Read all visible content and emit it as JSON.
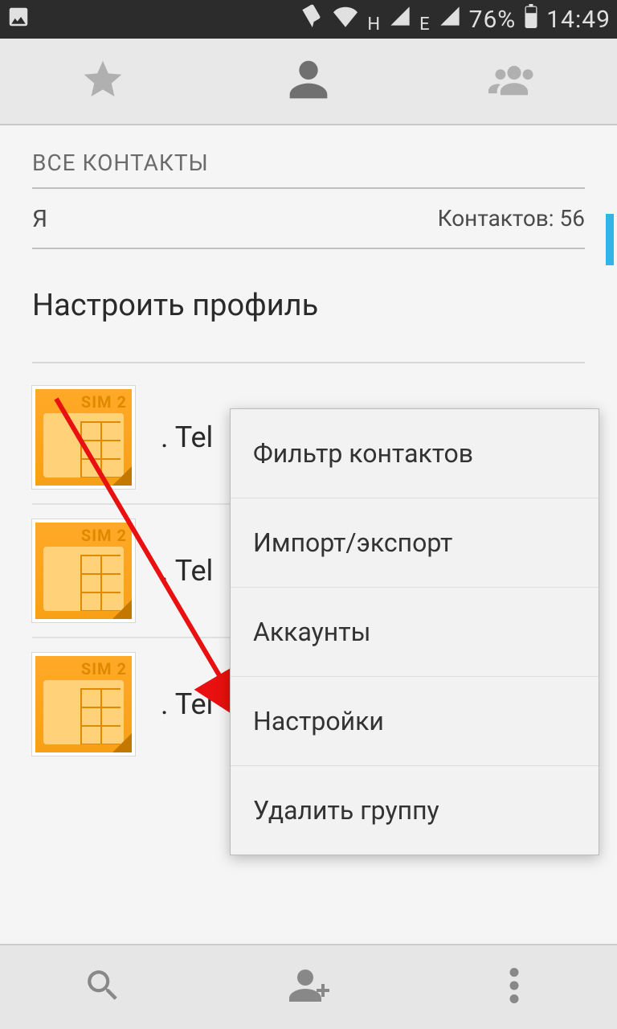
{
  "status": {
    "signal_h_label": "H",
    "signal_e_label": "E",
    "battery": "76%",
    "time": "14:49"
  },
  "header": {
    "all_contacts": "ВСЕ КОНТАКТЫ"
  },
  "me_row": {
    "label": "Я",
    "count_label": "Контактов: 56"
  },
  "profile": {
    "setup": "Настроить профиль"
  },
  "sim_label": "SIM 2",
  "contacts": [
    {
      "name": ". Tel"
    },
    {
      "name": ". Tel"
    },
    {
      "name": ". Tel"
    }
  ],
  "menu": {
    "items": [
      "Фильтр контактов",
      "Импорт/экспорт",
      "Аккаунты",
      "Настройки",
      "Удалить группу"
    ]
  }
}
